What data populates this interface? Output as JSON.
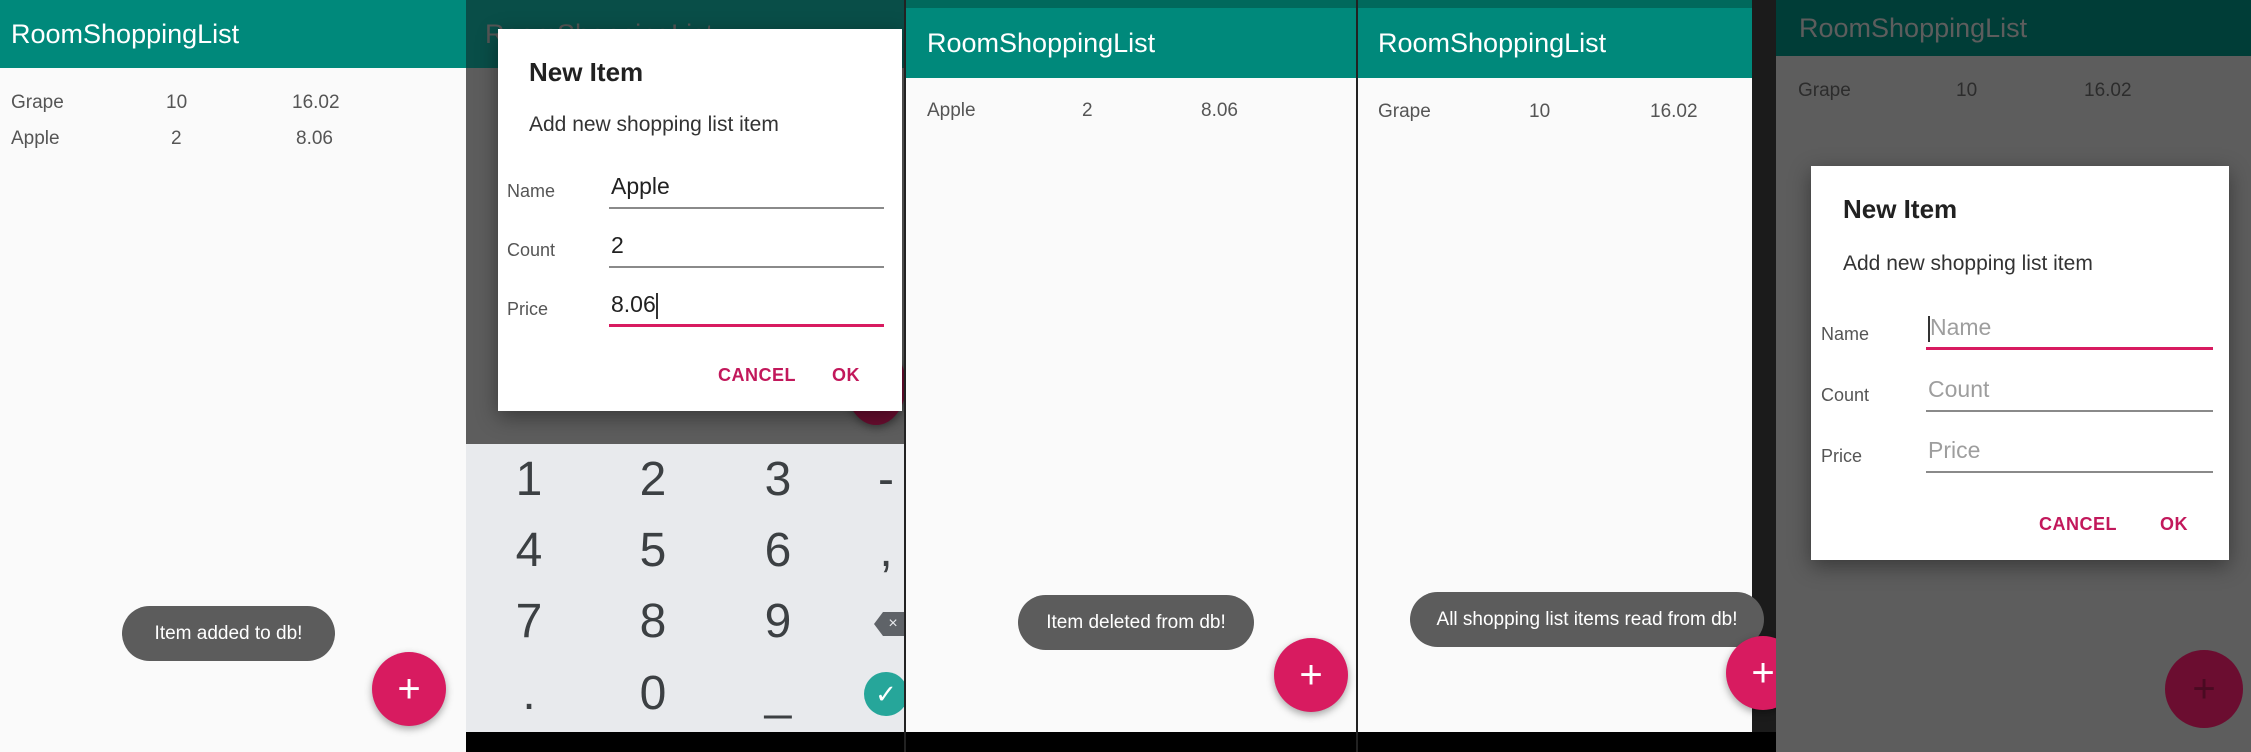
{
  "app": {
    "title": "RoomShoppingList"
  },
  "screen1": {
    "rows": [
      {
        "name": "Grape",
        "count": "10",
        "price": "16.02"
      },
      {
        "name": "Apple",
        "count": "2",
        "price": "8.06"
      }
    ],
    "toast": "Item added to db!",
    "fab": "+"
  },
  "screen2": {
    "dialog": {
      "title": "New Item",
      "message": "Add new shopping list item",
      "name_label": "Name",
      "name_value": "Apple",
      "count_label": "Count",
      "count_value": "2",
      "price_label": "Price",
      "price_value": "8.06",
      "cancel": "CANCEL",
      "ok": "OK"
    },
    "keyboard": {
      "keys": [
        "1",
        "2",
        "3",
        "-",
        "4",
        "5",
        "6",
        ",",
        "7",
        "8",
        "9",
        ".",
        "0",
        "_"
      ]
    }
  },
  "screen3": {
    "rows": [
      {
        "name": "Apple",
        "count": "2",
        "price": "8.06"
      }
    ],
    "toast": "Item deleted from db!",
    "fab": "+"
  },
  "screen4": {
    "rows": [
      {
        "name": "Grape",
        "count": "10",
        "price": "16.02"
      }
    ],
    "toast": "All shopping list items read from db!",
    "fab": "+"
  },
  "screen5": {
    "rows": [
      {
        "name": "Grape",
        "count": "10",
        "price": "16.02"
      }
    ],
    "dialog": {
      "title": "New Item",
      "message": "Add new shopping list item",
      "name_label": "Name",
      "name_placeholder": "Name",
      "count_label": "Count",
      "count_placeholder": "Count",
      "price_label": "Price",
      "price_placeholder": "Price",
      "cancel": "CANCEL",
      "ok": "OK"
    },
    "fab": "+"
  },
  "colors": {
    "primary": "#00897b",
    "accent": "#d81b60",
    "toast": "#5c5c5c"
  }
}
